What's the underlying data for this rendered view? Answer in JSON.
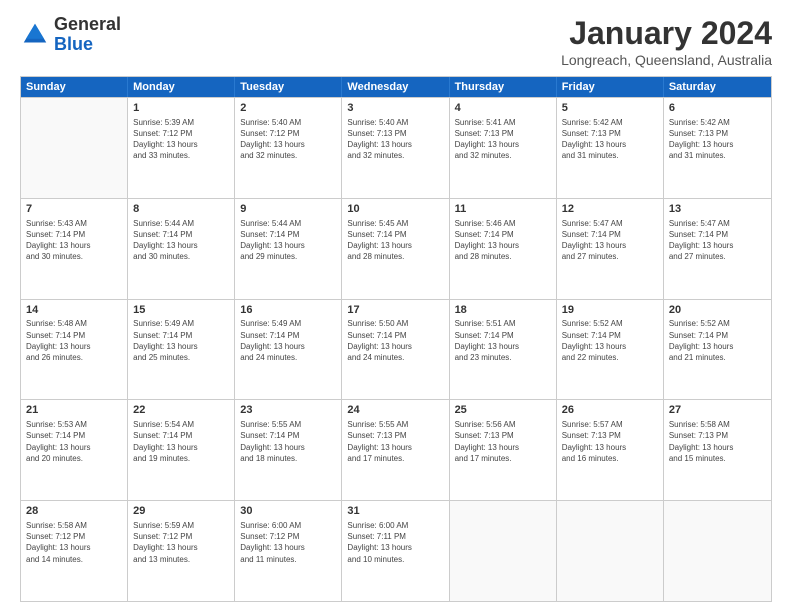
{
  "logo": {
    "general": "General",
    "blue": "Blue"
  },
  "title": "January 2024",
  "location": "Longreach, Queensland, Australia",
  "header_days": [
    "Sunday",
    "Monday",
    "Tuesday",
    "Wednesday",
    "Thursday",
    "Friday",
    "Saturday"
  ],
  "rows": [
    [
      {
        "day": "",
        "info": ""
      },
      {
        "day": "1",
        "info": "Sunrise: 5:39 AM\nSunset: 7:12 PM\nDaylight: 13 hours\nand 33 minutes."
      },
      {
        "day": "2",
        "info": "Sunrise: 5:40 AM\nSunset: 7:12 PM\nDaylight: 13 hours\nand 32 minutes."
      },
      {
        "day": "3",
        "info": "Sunrise: 5:40 AM\nSunset: 7:13 PM\nDaylight: 13 hours\nand 32 minutes."
      },
      {
        "day": "4",
        "info": "Sunrise: 5:41 AM\nSunset: 7:13 PM\nDaylight: 13 hours\nand 32 minutes."
      },
      {
        "day": "5",
        "info": "Sunrise: 5:42 AM\nSunset: 7:13 PM\nDaylight: 13 hours\nand 31 minutes."
      },
      {
        "day": "6",
        "info": "Sunrise: 5:42 AM\nSunset: 7:13 PM\nDaylight: 13 hours\nand 31 minutes."
      }
    ],
    [
      {
        "day": "7",
        "info": "Sunrise: 5:43 AM\nSunset: 7:14 PM\nDaylight: 13 hours\nand 30 minutes."
      },
      {
        "day": "8",
        "info": "Sunrise: 5:44 AM\nSunset: 7:14 PM\nDaylight: 13 hours\nand 30 minutes."
      },
      {
        "day": "9",
        "info": "Sunrise: 5:44 AM\nSunset: 7:14 PM\nDaylight: 13 hours\nand 29 minutes."
      },
      {
        "day": "10",
        "info": "Sunrise: 5:45 AM\nSunset: 7:14 PM\nDaylight: 13 hours\nand 28 minutes."
      },
      {
        "day": "11",
        "info": "Sunrise: 5:46 AM\nSunset: 7:14 PM\nDaylight: 13 hours\nand 28 minutes."
      },
      {
        "day": "12",
        "info": "Sunrise: 5:47 AM\nSunset: 7:14 PM\nDaylight: 13 hours\nand 27 minutes."
      },
      {
        "day": "13",
        "info": "Sunrise: 5:47 AM\nSunset: 7:14 PM\nDaylight: 13 hours\nand 27 minutes."
      }
    ],
    [
      {
        "day": "14",
        "info": "Sunrise: 5:48 AM\nSunset: 7:14 PM\nDaylight: 13 hours\nand 26 minutes."
      },
      {
        "day": "15",
        "info": "Sunrise: 5:49 AM\nSunset: 7:14 PM\nDaylight: 13 hours\nand 25 minutes."
      },
      {
        "day": "16",
        "info": "Sunrise: 5:49 AM\nSunset: 7:14 PM\nDaylight: 13 hours\nand 24 minutes."
      },
      {
        "day": "17",
        "info": "Sunrise: 5:50 AM\nSunset: 7:14 PM\nDaylight: 13 hours\nand 24 minutes."
      },
      {
        "day": "18",
        "info": "Sunrise: 5:51 AM\nSunset: 7:14 PM\nDaylight: 13 hours\nand 23 minutes."
      },
      {
        "day": "19",
        "info": "Sunrise: 5:52 AM\nSunset: 7:14 PM\nDaylight: 13 hours\nand 22 minutes."
      },
      {
        "day": "20",
        "info": "Sunrise: 5:52 AM\nSunset: 7:14 PM\nDaylight: 13 hours\nand 21 minutes."
      }
    ],
    [
      {
        "day": "21",
        "info": "Sunrise: 5:53 AM\nSunset: 7:14 PM\nDaylight: 13 hours\nand 20 minutes."
      },
      {
        "day": "22",
        "info": "Sunrise: 5:54 AM\nSunset: 7:14 PM\nDaylight: 13 hours\nand 19 minutes."
      },
      {
        "day": "23",
        "info": "Sunrise: 5:55 AM\nSunset: 7:14 PM\nDaylight: 13 hours\nand 18 minutes."
      },
      {
        "day": "24",
        "info": "Sunrise: 5:55 AM\nSunset: 7:13 PM\nDaylight: 13 hours\nand 17 minutes."
      },
      {
        "day": "25",
        "info": "Sunrise: 5:56 AM\nSunset: 7:13 PM\nDaylight: 13 hours\nand 17 minutes."
      },
      {
        "day": "26",
        "info": "Sunrise: 5:57 AM\nSunset: 7:13 PM\nDaylight: 13 hours\nand 16 minutes."
      },
      {
        "day": "27",
        "info": "Sunrise: 5:58 AM\nSunset: 7:13 PM\nDaylight: 13 hours\nand 15 minutes."
      }
    ],
    [
      {
        "day": "28",
        "info": "Sunrise: 5:58 AM\nSunset: 7:12 PM\nDaylight: 13 hours\nand 14 minutes."
      },
      {
        "day": "29",
        "info": "Sunrise: 5:59 AM\nSunset: 7:12 PM\nDaylight: 13 hours\nand 13 minutes."
      },
      {
        "day": "30",
        "info": "Sunrise: 6:00 AM\nSunset: 7:12 PM\nDaylight: 13 hours\nand 11 minutes."
      },
      {
        "day": "31",
        "info": "Sunrise: 6:00 AM\nSunset: 7:11 PM\nDaylight: 13 hours\nand 10 minutes."
      },
      {
        "day": "",
        "info": ""
      },
      {
        "day": "",
        "info": ""
      },
      {
        "day": "",
        "info": ""
      }
    ]
  ]
}
